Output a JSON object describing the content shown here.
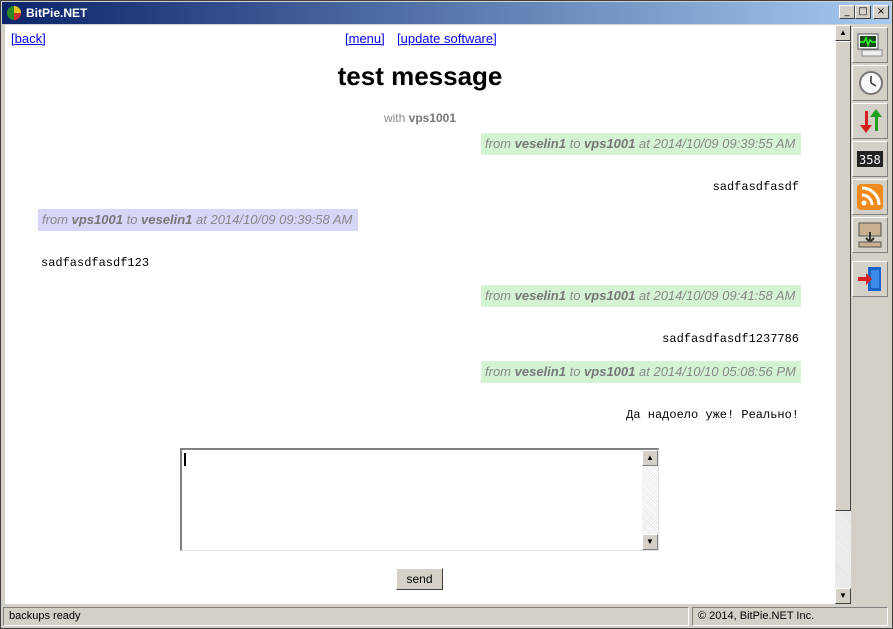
{
  "window": {
    "title": "BitPie.NET"
  },
  "nav": {
    "back": "[back]",
    "menu": "[menu]",
    "update": "[update software]"
  },
  "page": {
    "title": "test message",
    "with_label": "with",
    "with_user": "vps1001"
  },
  "labels": {
    "from": "from",
    "to": "to",
    "at": "at"
  },
  "messages": [
    {
      "from": "veselin1",
      "to": "vps1001",
      "time": "2014/10/09 09:39:55 AM",
      "text": "sadfasdfasdf",
      "side": "right"
    },
    {
      "from": "vps1001",
      "to": "veselin1",
      "time": "2014/10/09 09:39:58 AM",
      "text": "sadfasdfasdf123",
      "side": "left"
    },
    {
      "from": "veselin1",
      "to": "vps1001",
      "time": "2014/10/09 09:41:58 AM",
      "text": "sadfasdfasdf1237786",
      "side": "right"
    },
    {
      "from": "veselin1",
      "to": "vps1001",
      "time": "2014/10/10 05:08:56 PM",
      "text": "Да надоело уже! Реально!",
      "side": "right"
    }
  ],
  "composer": {
    "value": "",
    "send_label": "send"
  },
  "toolbar": {
    "icons": [
      "monitor-icon",
      "clock-icon",
      "transfer-arrows-icon",
      "counter-icon",
      "rss-icon",
      "download-computer-icon",
      "exit-door-icon"
    ]
  },
  "colors": {
    "outgoing_header": "#d4f2d4",
    "incoming_header": "#d6d6f8",
    "link": "#0000ee"
  },
  "status": {
    "left": "backups ready",
    "right": "© 2014, BitPie.NET Inc."
  }
}
